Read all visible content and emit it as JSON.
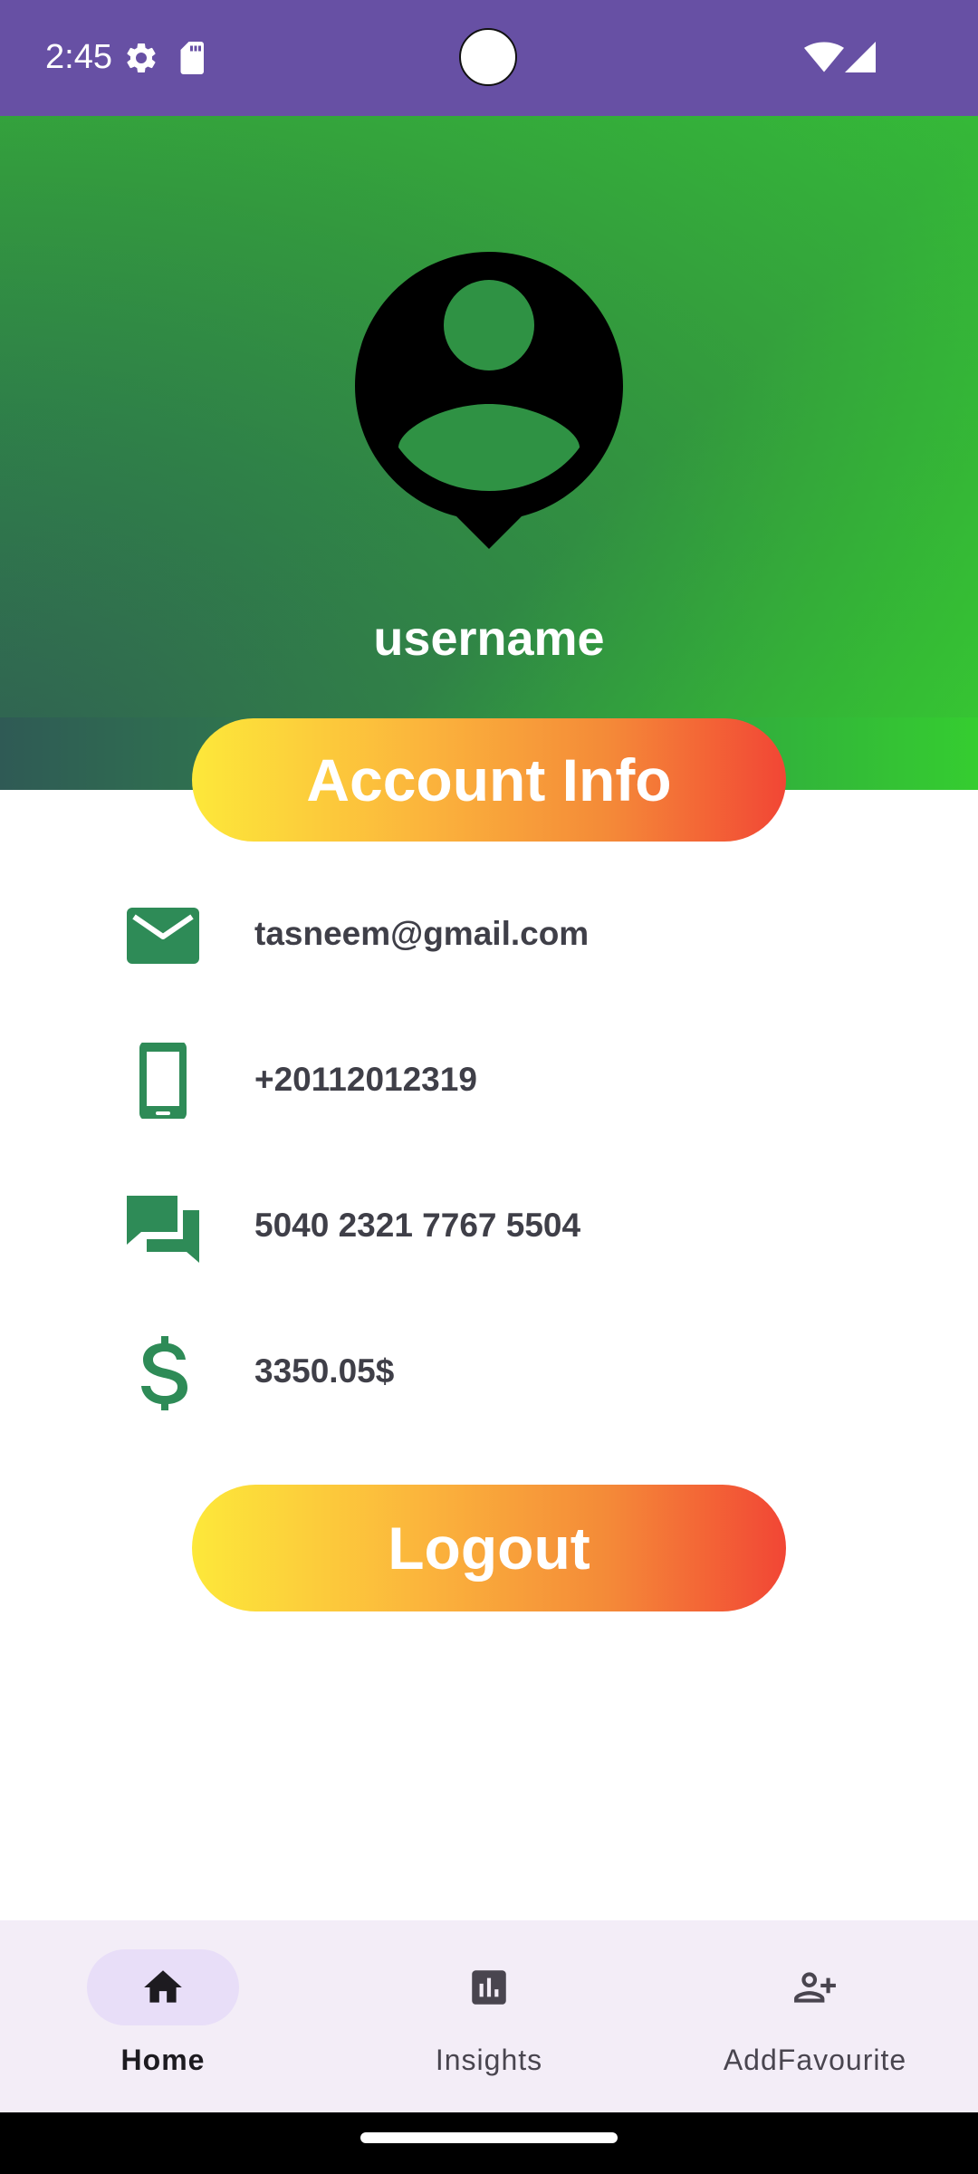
{
  "status_bar": {
    "time": "2:45",
    "icons": [
      "settings-gear-icon",
      "sd-card-icon",
      "wifi-icon",
      "cell-signal-icon"
    ],
    "color": "#6750A4"
  },
  "header": {
    "avatar_icon": "account-pin-icon",
    "username": "username",
    "gradient_colors": [
      "#2f4f5a",
      "#2e7d4a",
      "#36c936"
    ]
  },
  "account_info": {
    "title": "Account Info",
    "items": [
      {
        "icon": "email-icon",
        "value": "tasneem@gmail.com"
      },
      {
        "icon": "phone-icon",
        "value": "+20112012319"
      },
      {
        "icon": "chat-icon",
        "value": "5040 2321 7767 5504"
      },
      {
        "icon": "dollar-icon",
        "value": "3350.05$"
      }
    ],
    "icon_color": "#2E8B57"
  },
  "logout": {
    "label": "Logout"
  },
  "pill_gradient": [
    "#fde83a",
    "#f24635"
  ],
  "bottom_nav": {
    "items": [
      {
        "label": "Home",
        "icon": "home-icon",
        "active": true
      },
      {
        "label": "Insights",
        "icon": "insights-icon",
        "active": false
      },
      {
        "label": "AddFavourite",
        "icon": "add-person-icon",
        "active": false
      }
    ]
  }
}
